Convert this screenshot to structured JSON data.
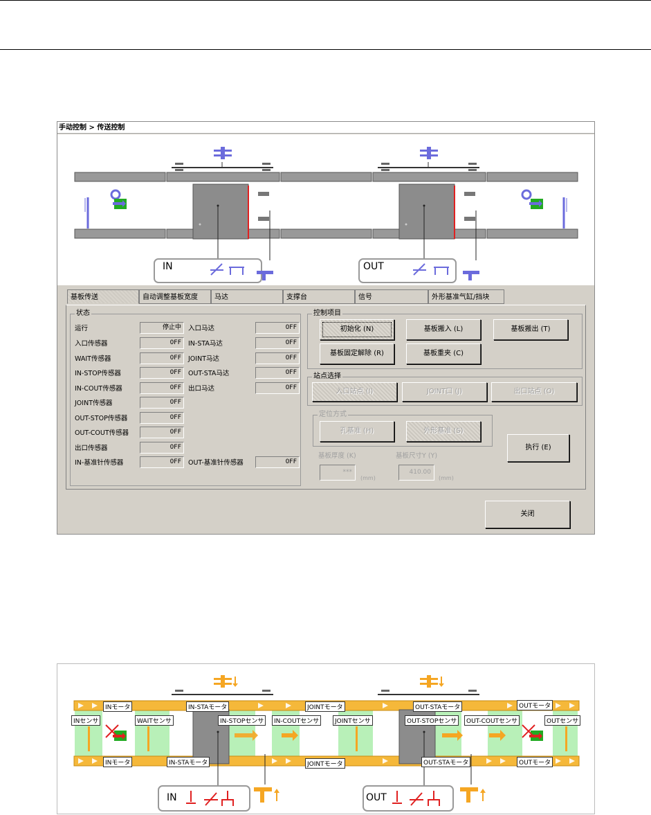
{
  "window": {
    "title": "手动控制 > 传送控制",
    "diagram": {
      "in_label": "IN",
      "out_label": "OUT"
    }
  },
  "tabs": [
    "基板传送",
    "自动调整基板宽度",
    "马达",
    "支撑台",
    "信号",
    "外形基准气缸/挡块"
  ],
  "status": {
    "title": "状态",
    "left": [
      {
        "label": "运行",
        "value": "停止中"
      },
      {
        "label": "入口传感器",
        "value": "OFF"
      },
      {
        "label": "WAIT传感器",
        "value": "OFF"
      },
      {
        "label": "IN-STOP传感器",
        "value": "OFF"
      },
      {
        "label": "IN-COUT传感器",
        "value": "OFF"
      },
      {
        "label": "JOINT传感器",
        "value": "OFF"
      },
      {
        "label": "OUT-STOP传感器",
        "value": "OFF"
      },
      {
        "label": "OUT-COUT传感器",
        "value": "OFF"
      },
      {
        "label": "出口传感器",
        "value": "OFF"
      },
      {
        "label": "IN-基准针传感器",
        "value": "OFF"
      }
    ],
    "right": [
      {
        "label": "入口马达",
        "value": "OFF"
      },
      {
        "label": "IN-STA马达",
        "value": "OFF"
      },
      {
        "label": "JOINT马达",
        "value": "OFF"
      },
      {
        "label": "OUT-STA马达",
        "value": "OFF"
      },
      {
        "label": "出口马达",
        "value": "OFF"
      }
    ],
    "bottom_right": {
      "label": "OUT-基准针传感器",
      "value": "OFF"
    }
  },
  "control": {
    "title": "控制项目",
    "init": "初始化 (N)",
    "load": "基板搬入 (L)",
    "unload": "基板搬出 (T)",
    "release": "基板固定解除 (R)",
    "reclamp": "基板重夹 (C)"
  },
  "station": {
    "title": "站点选择",
    "in": "入口站点 (I)",
    "joint": "JOINT口 (J)",
    "out": "出口站点 (O)"
  },
  "positioning": {
    "title": "定位方式",
    "hole": "孔基准 (H)",
    "shape": "外形基准 (S)"
  },
  "execute": "执行 (E)",
  "thickness": {
    "label": "基板厚度 (K)",
    "value": "***",
    "unit": "(mm)"
  },
  "size": {
    "label": "基板尺寸Y (Y)",
    "value": "410.00",
    "unit": "(mm)"
  },
  "close": "关闭",
  "figure2": {
    "in_label": "IN",
    "out_label": "OUT",
    "tags": {
      "in_motor_top": "INモータ",
      "in_sta_motor_top": "IN-STAモータ",
      "joint_motor_top": "JOINTモータ",
      "out_sta_motor_top": "OUT-STAモータ",
      "out_motor_top": "OUTモータ",
      "in_sensor": "INセンサ",
      "wait_sensor": "WAITセンサ",
      "in_stop_sensor": "IN-STOPセンサ",
      "in_cout_sensor": "IN-COUTセンサ",
      "joint_sensor": "JOINTセンサ",
      "out_stop_sensor": "OUT-STOPセンサ",
      "out_cout_sensor": "OUT-COUTセンサ",
      "out_sensor": "OUTセンサ",
      "in_motor_bottom": "INモータ",
      "in_sta_motor_bottom": "IN-STAモータ",
      "joint_motor_bottom": "JOINTモータ",
      "out_sta_motor_bottom": "OUT-STAモータ",
      "out_motor_bottom": "OUTモータ"
    }
  }
}
